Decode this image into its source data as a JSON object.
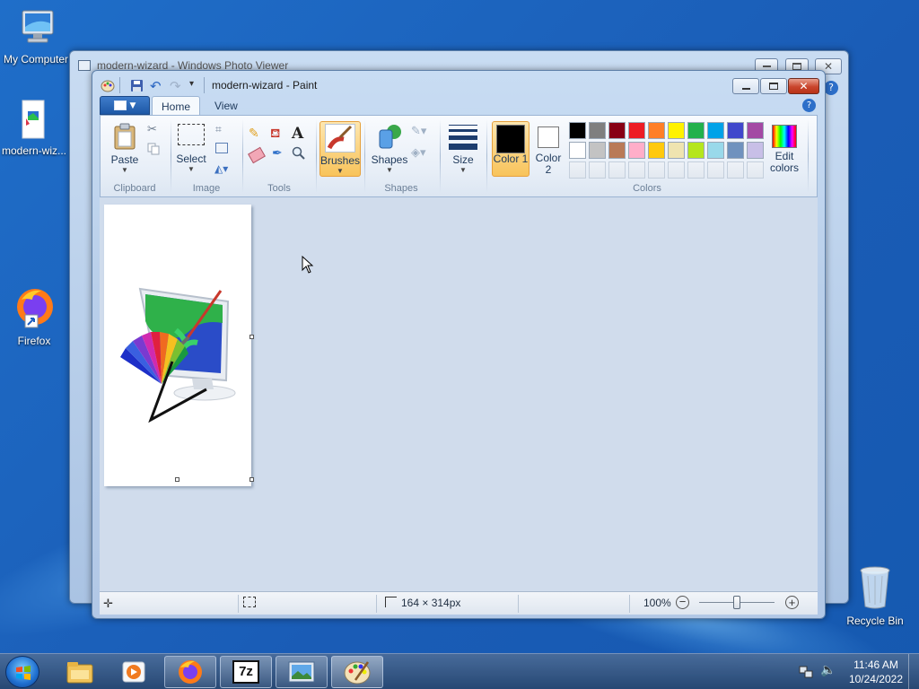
{
  "desktop": {
    "icons": [
      {
        "label": "My Computer"
      },
      {
        "label": "modern-wiz..."
      },
      {
        "label": "Firefox"
      },
      {
        "label": "Recycle Bin"
      }
    ]
  },
  "photo_viewer": {
    "title": "modern-wizard - Windows Photo Viewer"
  },
  "paint": {
    "title": "modern-wizard - Paint",
    "tabs": {
      "home": "Home",
      "view": "View"
    },
    "groups": {
      "clipboard": {
        "label": "Clipboard",
        "paste": "Paste"
      },
      "image": {
        "label": "Image",
        "select": "Select"
      },
      "tools": {
        "label": "Tools"
      },
      "brushes": {
        "label": "Brushes"
      },
      "shapes": {
        "label": "Shapes",
        "shapes_btn": "Shapes"
      },
      "size": {
        "label": "Size"
      },
      "colors": {
        "label": "Colors",
        "color1": "Color 1",
        "color2": "Color 2",
        "edit": "Edit colors",
        "color1_value": "#000000",
        "color2_value": "#ffffff",
        "palette_row1": [
          "#000000",
          "#7f7f7f",
          "#880015",
          "#ed1c24",
          "#ff7f27",
          "#fff200",
          "#22b14c",
          "#00a2e8",
          "#3f48cc",
          "#a349a4"
        ],
        "palette_row2": [
          "#ffffff",
          "#c3c3c3",
          "#b97a57",
          "#ffaec9",
          "#ffc90e",
          "#efe4b0",
          "#b5e61d",
          "#99d9ea",
          "#7092be",
          "#c8bfe7"
        ]
      }
    },
    "status": {
      "dimensions": "164 × 314px",
      "zoom": "100%"
    }
  },
  "taskbar": {
    "time": "11:46 AM",
    "date": "10/24/2022"
  }
}
